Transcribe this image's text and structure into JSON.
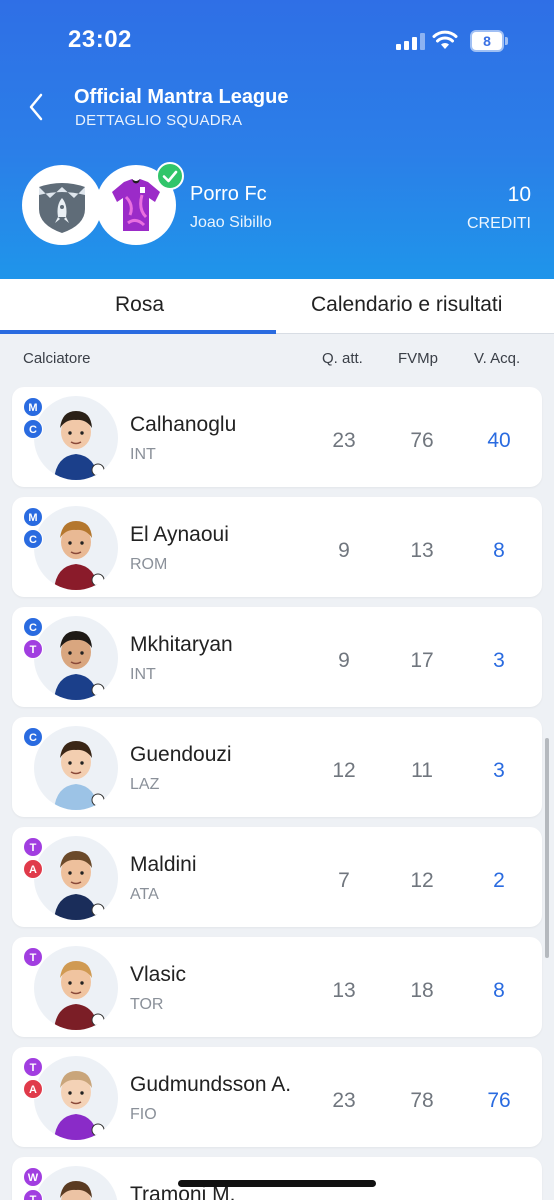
{
  "status_bar": {
    "time": "23:02",
    "battery": "8"
  },
  "nav": {
    "title": "Official Mantra League",
    "subtitle": "DETTAGLIO SQUADRA"
  },
  "team": {
    "name": "Porro Fc",
    "owner": "Joao Sibillo",
    "credits_value": "10",
    "credits_label": "CREDITI"
  },
  "tabs": [
    {
      "label": "Rosa",
      "active": true
    },
    {
      "label": "Calendario e risultati",
      "active": false
    }
  ],
  "columns": {
    "player": "Calciatore",
    "q_att": "Q. att.",
    "fvmp": "FVMp",
    "v_acq": "V. Acq."
  },
  "role_colors": {
    "M": "#2a6be0",
    "C": "#2a6be0",
    "T": "#a13ee0",
    "A": "#e03a4a",
    "W": "#a13ee0"
  },
  "players": [
    {
      "name": "Calhanoglu",
      "team": "INT",
      "roles": [
        "M",
        "C"
      ],
      "q_att": "23",
      "fvmp": "76",
      "v_acq": "40"
    },
    {
      "name": "El Aynaoui",
      "team": "ROM",
      "roles": [
        "M",
        "C"
      ],
      "q_att": "9",
      "fvmp": "13",
      "v_acq": "8"
    },
    {
      "name": "Mkhitaryan",
      "team": "INT",
      "roles": [
        "C",
        "T"
      ],
      "q_att": "9",
      "fvmp": "17",
      "v_acq": "3"
    },
    {
      "name": "Guendouzi",
      "team": "LAZ",
      "roles": [
        "C"
      ],
      "q_att": "12",
      "fvmp": "11",
      "v_acq": "3"
    },
    {
      "name": "Maldini",
      "team": "ATA",
      "roles": [
        "T",
        "A"
      ],
      "q_att": "7",
      "fvmp": "12",
      "v_acq": "2"
    },
    {
      "name": "Vlasic",
      "team": "TOR",
      "roles": [
        "T"
      ],
      "q_att": "13",
      "fvmp": "18",
      "v_acq": "8"
    },
    {
      "name": "Gudmundsson A.",
      "team": "FIO",
      "roles": [
        "T",
        "A"
      ],
      "q_att": "23",
      "fvmp": "78",
      "v_acq": "76"
    },
    {
      "name": "Tramoni M.",
      "team": "",
      "roles": [
        "W",
        "T"
      ],
      "q_att": "",
      "fvmp": "",
      "v_acq": ""
    }
  ]
}
